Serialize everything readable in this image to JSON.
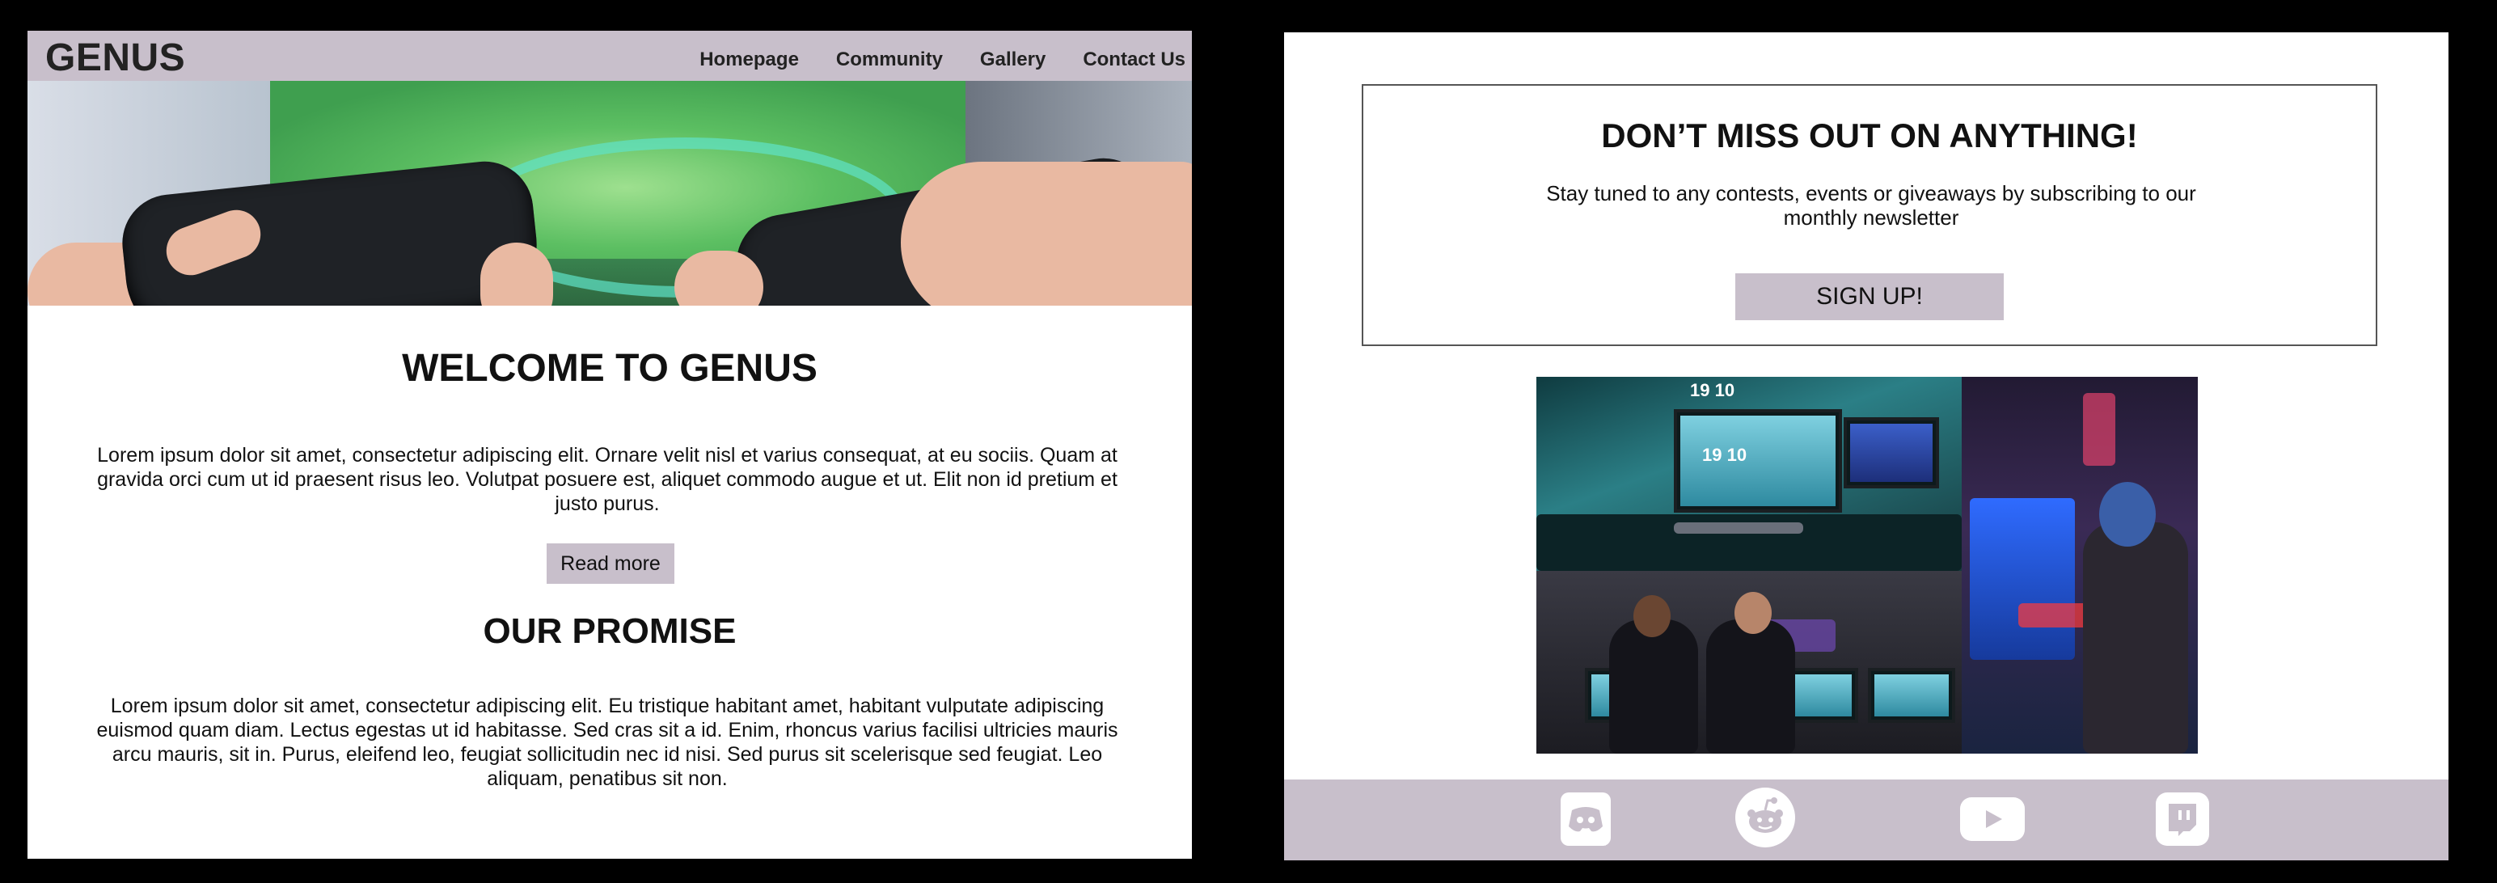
{
  "left_page": {
    "logo": "GENUS",
    "nav": {
      "items": [
        {
          "label": "Homepage"
        },
        {
          "label": "Community"
        },
        {
          "label": "Gallery"
        },
        {
          "label": "Contact Us"
        }
      ]
    },
    "welcome": {
      "title": "WELCOME TO GENUS",
      "text": "Lorem ipsum dolor sit amet, consectetur adipiscing elit. Ornare velit nisl et varius consequat, at eu sociis. Quam at gravida orci cum ut id praesent risus leo. Volutpat posuere est, aliquet commodo augue et ut. Elit non id pretium et justo purus.",
      "button_label": "Read more"
    },
    "promise": {
      "title": "OUR PROMISE",
      "text": "Lorem ipsum dolor sit amet, consectetur adipiscing elit. Eu tristique habitant amet, habitant vulputate adipiscing euismod quam diam. Lectus egestas ut id habitasse. Sed cras sit a id. Enim, rhoncus varius facilisi ultricies mauris arcu mauris, sit in. Purus, eleifend leo, feugiat sollicitudin nec id nisi. Sed purus sit scelerisque sed feugiat. Leo aliquam, penatibus sit non."
    }
  },
  "right_page": {
    "newsletter": {
      "title": "DON’T MISS OUT ON ANYTHING!",
      "text": "Stay tuned to any contests, events or giveaways by subscribing to our monthly newsletter",
      "button_label": "SIGN UP!"
    },
    "collage": {
      "clock_text": "19 10"
    },
    "footer": {
      "icons": [
        "discord-icon",
        "reddit-icon",
        "youtube-icon",
        "twitch-icon"
      ]
    }
  },
  "colors": {
    "accent": "#c8bfcb",
    "background": "#000000",
    "panel": "#ffffff"
  }
}
